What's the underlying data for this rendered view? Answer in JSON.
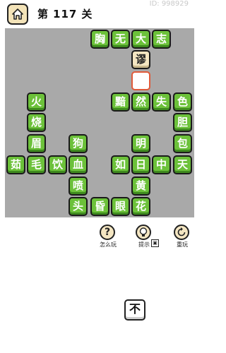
{
  "header": {
    "home_icon": "home-icon",
    "level_prefix": "第",
    "level_number": "117",
    "level_suffix": "关",
    "id_text": "ID: 998929"
  },
  "board": {
    "tiles": [
      {
        "ch": "胸",
        "state": "normal"
      },
      {
        "ch": "无",
        "state": "normal"
      },
      {
        "ch": "大",
        "state": "normal"
      },
      {
        "ch": "志",
        "state": "normal"
      },
      {
        "ch": "谬",
        "state": "filled"
      },
      {
        "ch": "",
        "state": "empty"
      },
      {
        "ch": "火",
        "state": "normal"
      },
      {
        "ch": "黯",
        "state": "normal"
      },
      {
        "ch": "然",
        "state": "normal"
      },
      {
        "ch": "失",
        "state": "normal"
      },
      {
        "ch": "色",
        "state": "normal"
      },
      {
        "ch": "烧",
        "state": "normal"
      },
      {
        "ch": "胆",
        "state": "normal"
      },
      {
        "ch": "眉",
        "state": "normal"
      },
      {
        "ch": "狗",
        "state": "normal"
      },
      {
        "ch": "明",
        "state": "normal"
      },
      {
        "ch": "包",
        "state": "normal"
      },
      {
        "ch": "茹",
        "state": "normal"
      },
      {
        "ch": "毛",
        "state": "normal"
      },
      {
        "ch": "饮",
        "state": "normal"
      },
      {
        "ch": "血",
        "state": "normal"
      },
      {
        "ch": "如",
        "state": "normal"
      },
      {
        "ch": "日",
        "state": "normal"
      },
      {
        "ch": "中",
        "state": "normal"
      },
      {
        "ch": "天",
        "state": "normal"
      },
      {
        "ch": "喷",
        "state": "normal"
      },
      {
        "ch": "黄",
        "state": "normal"
      },
      {
        "ch": "头",
        "state": "normal"
      },
      {
        "ch": "昏",
        "state": "normal"
      },
      {
        "ch": "眼",
        "state": "normal"
      },
      {
        "ch": "花",
        "state": "normal"
      }
    ]
  },
  "tools": {
    "help_label": "怎么玩",
    "help_glyph": "?",
    "hint_label": "提示",
    "hint_badge": "▣",
    "replay_label": "重玩"
  },
  "choices": [
    "不"
  ]
}
